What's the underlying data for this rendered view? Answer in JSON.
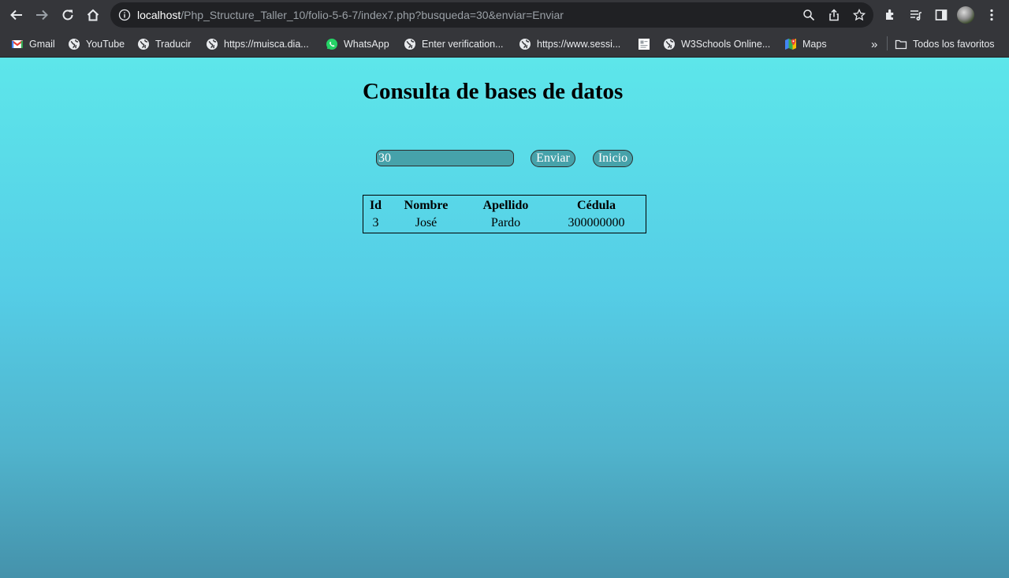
{
  "browser": {
    "url_host": "localhost",
    "url_path": "/Php_Structure_Taller_10/folio-5-6-7/index7.php?busqueda=30&enviar=Enviar",
    "bookmarks": [
      {
        "label": "Gmail",
        "icon": "gmail-icon"
      },
      {
        "label": "YouTube",
        "icon": "globe-icon"
      },
      {
        "label": "Traducir",
        "icon": "globe-icon"
      },
      {
        "label": "https://muisca.dia...",
        "icon": "globe-icon"
      },
      {
        "label": "WhatsApp",
        "icon": "whatsapp-icon"
      },
      {
        "label": "Enter verification...",
        "icon": "globe-icon"
      },
      {
        "label": "https://www.sessi...",
        "icon": "globe-icon"
      },
      {
        "label": "",
        "icon": "page-icon"
      },
      {
        "label": "W3Schools Online...",
        "icon": "globe-icon"
      },
      {
        "label": "Maps",
        "icon": "maps-icon"
      }
    ],
    "more_label": "»",
    "all_bookmarks_label": "Todos los favoritos"
  },
  "page": {
    "title": "Consulta de bases de datos",
    "search_value": "30",
    "send_label": "Enviar",
    "home_label": "Inicio",
    "table": {
      "headers": [
        "Id",
        "Nombre",
        "Apellido",
        "Cédula"
      ],
      "rows": [
        [
          "3",
          "José",
          "Pardo",
          "300000000"
        ]
      ]
    }
  },
  "colors": {
    "chrome": "#35363a",
    "omnibox": "#202124",
    "page_gradient_top": "#5de6ea",
    "page_gradient_bottom": "#4592ab",
    "control_fill": "#46a2aa"
  }
}
